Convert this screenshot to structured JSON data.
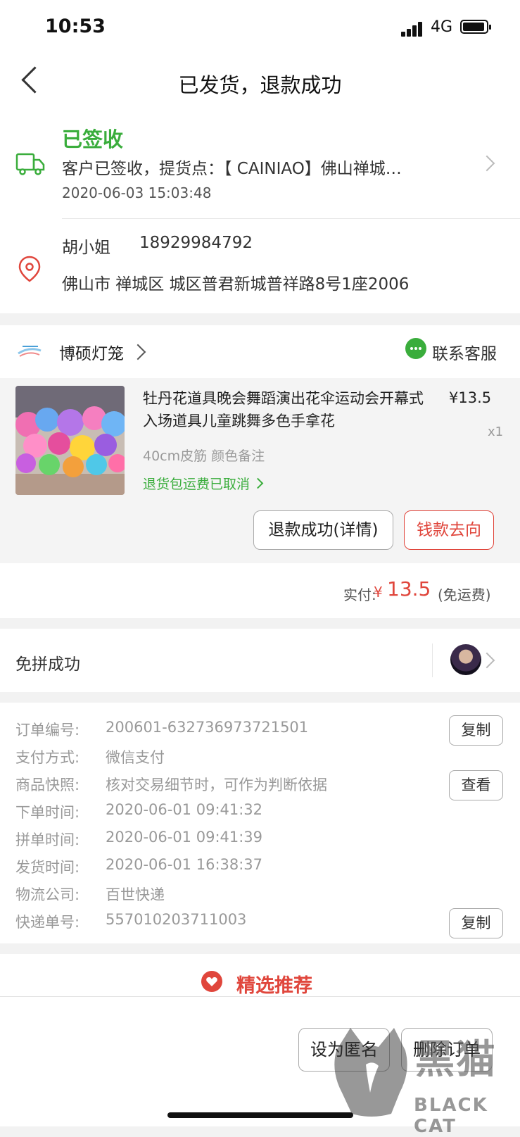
{
  "status_bar": {
    "time": "10:53",
    "network": "4G"
  },
  "nav": {
    "title": "已发货，退款成功"
  },
  "logistics": {
    "status": "已签收",
    "description": "客户已签收，提货点：【 CAINIAO】佛山禅城…",
    "time": "2020-06-03 15:03:48"
  },
  "address": {
    "name": "胡小姐",
    "phone": "18929984792",
    "detail": "佛山市 禅城区 城区普君新城普祥路8号1座2006"
  },
  "shop": {
    "name": "博硕灯笼",
    "contact_label": "联系客服"
  },
  "product": {
    "title": "牡丹花道具晚会舞蹈演出花伞运动会开幕式入场道具儿童跳舞多色手拿花",
    "price": "¥13.5",
    "quantity": "x1",
    "spec": "40cm皮筋 颜色备注",
    "refund_note": "退货包运费已取消"
  },
  "actions": {
    "refund_detail": "退款成功(详情)",
    "money_flow": "钱款去向"
  },
  "paid": {
    "label": "实付:",
    "currency": "¥",
    "amount": "13.5",
    "note": "(免运费)"
  },
  "group": {
    "label": "免拼成功"
  },
  "order_info": {
    "rows": [
      {
        "label": "订单编号:",
        "value": "200601-632736973721501",
        "button": "复制"
      },
      {
        "label": "支付方式:",
        "value": "微信支付"
      },
      {
        "label": "商品快照:",
        "value": "核对交易细节时，可作为判断依据",
        "button": "查看"
      },
      {
        "label": "下单时间:",
        "value": "2020-06-01 09:41:32"
      },
      {
        "label": "拼单时间:",
        "value": "2020-06-01 09:41:39"
      },
      {
        "label": "发货时间:",
        "value": "2020-06-01 16:38:37"
      },
      {
        "label": "物流公司:",
        "value": "百世快递"
      },
      {
        "label": "快递单号:",
        "value": "557010203711003",
        "button": "复制"
      }
    ]
  },
  "recommend": {
    "label": "精选推荐"
  },
  "bottom_bar": {
    "anonymous": "设为匿名",
    "delete": "删除订单"
  },
  "watermark": {
    "cn": "黑猫",
    "en": "BLACK CAT"
  },
  "colors": {
    "green": "#3aad3c",
    "red": "#e0463c"
  }
}
